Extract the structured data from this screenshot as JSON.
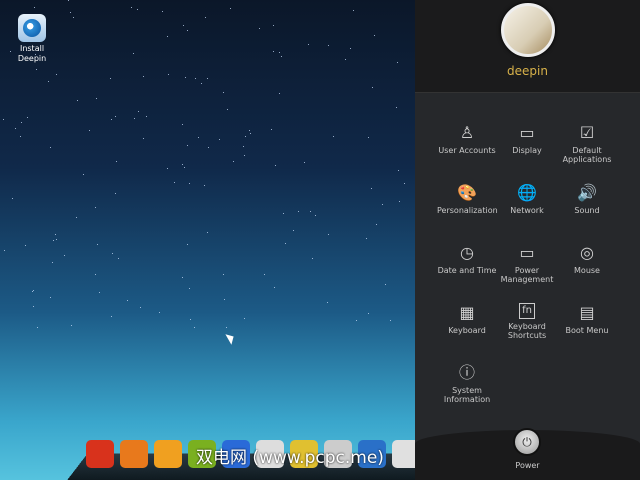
{
  "desktop": {
    "install_icon_label": "Install Deepin",
    "watermark": "双电网 (www.pcpc.me)"
  },
  "dock": {
    "apps": [
      "launcher",
      "app-2",
      "app-3",
      "app-4",
      "app-5",
      "chrome",
      "app-7",
      "app-8",
      "app-9",
      "app-10"
    ],
    "colors": [
      "#d8321c",
      "#e8791c",
      "#f0a020",
      "#7ab020",
      "#2a6ad8",
      "#dddddd",
      "#e0c030",
      "#cccccc",
      "#2a70c8",
      "#e0e0e0"
    ]
  },
  "panel": {
    "user_name": "deepin",
    "items": [
      {
        "label": "User Accounts",
        "icon": "user"
      },
      {
        "label": "Display",
        "icon": "monitor"
      },
      {
        "label": "Default Applications",
        "icon": "check-window"
      },
      {
        "label": "Personalization",
        "icon": "palette"
      },
      {
        "label": "Network",
        "icon": "globe"
      },
      {
        "label": "Sound",
        "icon": "speaker"
      },
      {
        "label": "Date and Time",
        "icon": "clock"
      },
      {
        "label": "Power Management",
        "icon": "battery"
      },
      {
        "label": "Mouse",
        "icon": "mouse"
      },
      {
        "label": "Keyboard",
        "icon": "keyboard"
      },
      {
        "label": "Keyboard Shortcuts",
        "icon": "fn-key"
      },
      {
        "label": "Boot Menu",
        "icon": "boot-screen"
      },
      {
        "label": "System Information",
        "icon": "info"
      }
    ],
    "power_label": "Power"
  }
}
